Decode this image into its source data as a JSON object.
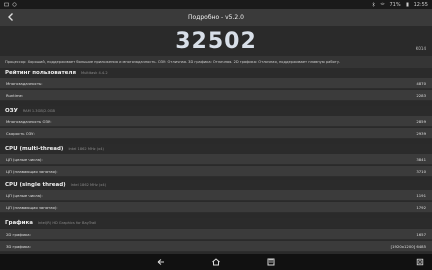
{
  "status": {
    "battery": "71%",
    "time": "12:55"
  },
  "header": {
    "title": "Подробно - v5.2.0"
  },
  "score": {
    "total": "32502",
    "device": "K014"
  },
  "summary": "Процессор: Хороший, поддерживает большие приложения и многозадачность. ОЗУ: Отличная. 3D графика: Отличная. 2D графика: Отличная, поддерживает плавную работу.",
  "sections": [
    {
      "name": "Рейтинг пользователя",
      "sub": "Multitask 4.4.2",
      "rows": [
        {
          "label": "Многозадачность:",
          "value": "4870"
        },
        {
          "label": "Runtime:",
          "value": "2283"
        }
      ]
    },
    {
      "name": "ОЗУ",
      "sub": "RAM 1.3GB/2.0GB",
      "rows": [
        {
          "label": "Многозадачность ОЗУ:",
          "value": "2859"
        },
        {
          "label": "Скорость ОЗУ:",
          "value": "2939"
        }
      ]
    },
    {
      "name": "CPU (multi-thread)",
      "sub": "Intel 1862 MHz (x4)",
      "rows": [
        {
          "label": "ЦП (целые числа):",
          "value": "3841"
        },
        {
          "label": "ЦП (плавающая запятая):",
          "value": "3710"
        }
      ]
    },
    {
      "name": "CPU (single thread)",
      "sub": "Intel 1862 MHz (x4)",
      "rows": [
        {
          "label": "ЦП (целые числа):",
          "value": "1191"
        },
        {
          "label": "ЦП (плавающая запятая):",
          "value": "1792"
        }
      ]
    },
    {
      "name": "Графика",
      "sub": "Intel(R) HD Graphics for BayTrail",
      "rows": [
        {
          "label": "2D графика:",
          "value": "1657"
        },
        {
          "label": "3D графика:",
          "value": "[1920x1200] 6485"
        }
      ]
    }
  ]
}
